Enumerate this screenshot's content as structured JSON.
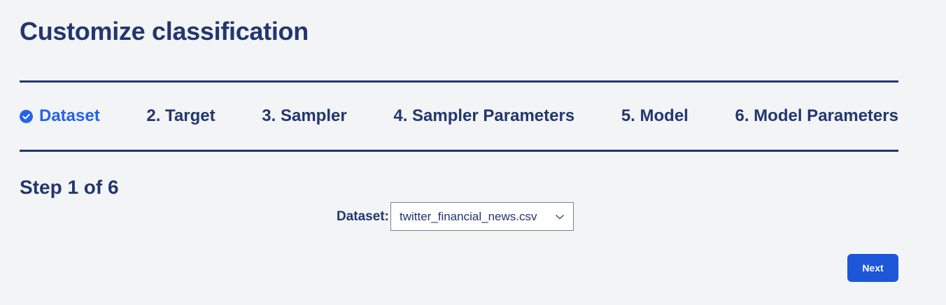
{
  "page": {
    "title": "Customize classification"
  },
  "stepper": {
    "steps": [
      {
        "label": "Dataset",
        "state": "completed",
        "icon": "check-circle-icon"
      },
      {
        "label": "2. Target"
      },
      {
        "label": "3. Sampler"
      },
      {
        "label": "4. Sampler Parameters"
      },
      {
        "label": "5. Model"
      },
      {
        "label": "6. Model Parameters"
      }
    ]
  },
  "step_indicator": "Step 1 of 6",
  "dataset": {
    "label": "Dataset:",
    "selected": "twitter_financial_news.csv",
    "icon": "chevron-down-icon"
  },
  "actions": {
    "next_label": "Next"
  },
  "colors": {
    "primary_text": "#23366f",
    "active_step": "#2563eb",
    "button": "#1d56d8",
    "background": "#f3f4f6"
  }
}
